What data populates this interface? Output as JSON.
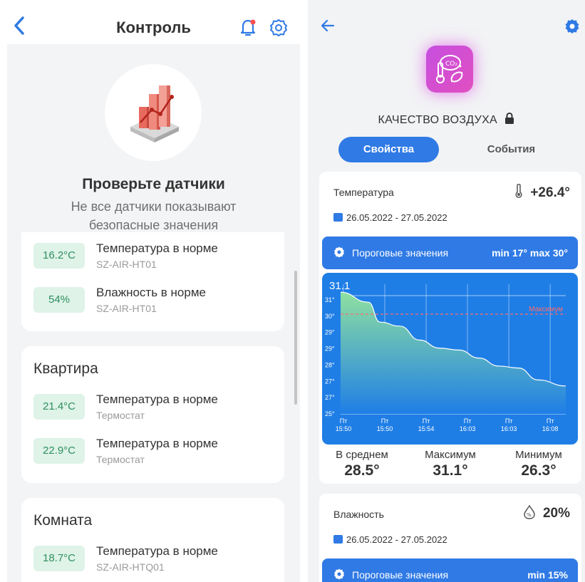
{
  "left": {
    "header": {
      "title": "Контроль"
    },
    "notice": {
      "title": "Проверьте датчики",
      "line1": "Не все датчики показывают",
      "line2": "безопасные значения"
    },
    "card1": {
      "items": [
        {
          "value": "16.2°C",
          "title": "Температура в норме",
          "sub": "SZ-AIR-HT01"
        },
        {
          "value": "54%",
          "title": "Влажность в норме",
          "sub": "SZ-AIR-HT01"
        }
      ]
    },
    "card2": {
      "title": "Квартира",
      "items": [
        {
          "value": "21.4°C",
          "title": "Температура в норме",
          "sub": "Термостат"
        },
        {
          "value": "22.9°C",
          "title": "Температура в норме",
          "sub": "Термостат"
        }
      ]
    },
    "card3": {
      "title": "Комната",
      "items": [
        {
          "value": "18.7°C",
          "title": "Температура в норме",
          "sub": "SZ-AIR-HTQ01"
        }
      ]
    }
  },
  "right": {
    "title": "КАЧЕСТВО ВОЗДУХА",
    "tabs": {
      "active": "Свойства",
      "inactive": "События"
    },
    "temperature": {
      "label": "Температура",
      "value": "+26.4°",
      "date": "26.05.2022 - 27.05.2022",
      "threshold": {
        "label": "Пороговые значения",
        "values": "min 17°  max 30°"
      }
    },
    "stats": [
      {
        "label": "В среднем",
        "value": "28.5°"
      },
      {
        "label": "Максимум",
        "value": "31.1°"
      },
      {
        "label": "Минимум",
        "value": "26.3°"
      }
    ],
    "humidity": {
      "label": "Влажность",
      "value": "20%",
      "date": "26.05.2022 - 27.05.2022",
      "threshold": {
        "label": "Пороговые значения",
        "values": "min 15%"
      }
    }
  },
  "colors": {
    "accent": "#2f7ae5",
    "chip_bg": "#dff3e8",
    "chip_text": "#2f8f5e",
    "chart_bg": "#1f7ee6",
    "max_line": "#ff6b6b"
  },
  "chart_data": {
    "type": "area",
    "current_label": "31.1",
    "max_label": "Максимум",
    "max_value": 30,
    "ylim": [
      25,
      31
    ],
    "yticks": [
      "25°",
      "27°",
      "27°",
      "28°",
      "29°",
      "29°",
      "30°",
      "31°"
    ],
    "xticks": [
      {
        "top": "Пт",
        "bottom": "15:50"
      },
      {
        "top": "Пт",
        "bottom": "15:50"
      },
      {
        "top": "Пт",
        "bottom": "15:54"
      },
      {
        "top": "Пт",
        "bottom": "16:03"
      },
      {
        "top": "Пт",
        "bottom": "16:03"
      },
      {
        "top": "Пт",
        "bottom": "16:08"
      }
    ],
    "x": [
      0,
      0.7,
      1,
      1.5,
      2,
      2.5,
      3,
      3.5,
      4,
      4.5,
      5,
      5.7
    ],
    "y": [
      31.1,
      30.6,
      29.6,
      29.4,
      28.7,
      28.3,
      28.2,
      27.8,
      27.4,
      27.3,
      26.7,
      26.4
    ]
  }
}
